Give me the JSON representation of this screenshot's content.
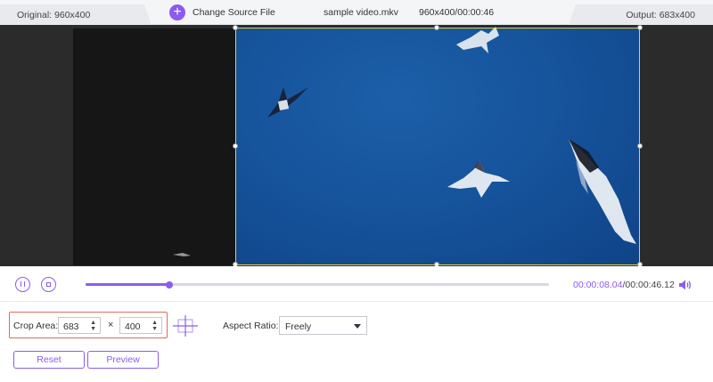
{
  "header": {
    "original": "Original: 960x400",
    "change_source": "Change Source File",
    "file_name": "sample video.mkv",
    "file_meta": "960x400/00:00:46",
    "output": "Output: 683x400"
  },
  "player": {
    "current_time": "00:00:08.04",
    "total_time": "/00:00:46.12",
    "progress": 0.18
  },
  "crop": {
    "label": "Crop Area:",
    "width": "683",
    "separator": "×",
    "height": "400",
    "aspect_label": "Aspect Ratio:",
    "aspect_value": "Freely"
  },
  "buttons": {
    "reset": "Reset",
    "preview": "Preview"
  },
  "colors": {
    "accent": "#8a5cf0",
    "crop_border": "#e8d43a",
    "highlight": "#e06a5d"
  }
}
